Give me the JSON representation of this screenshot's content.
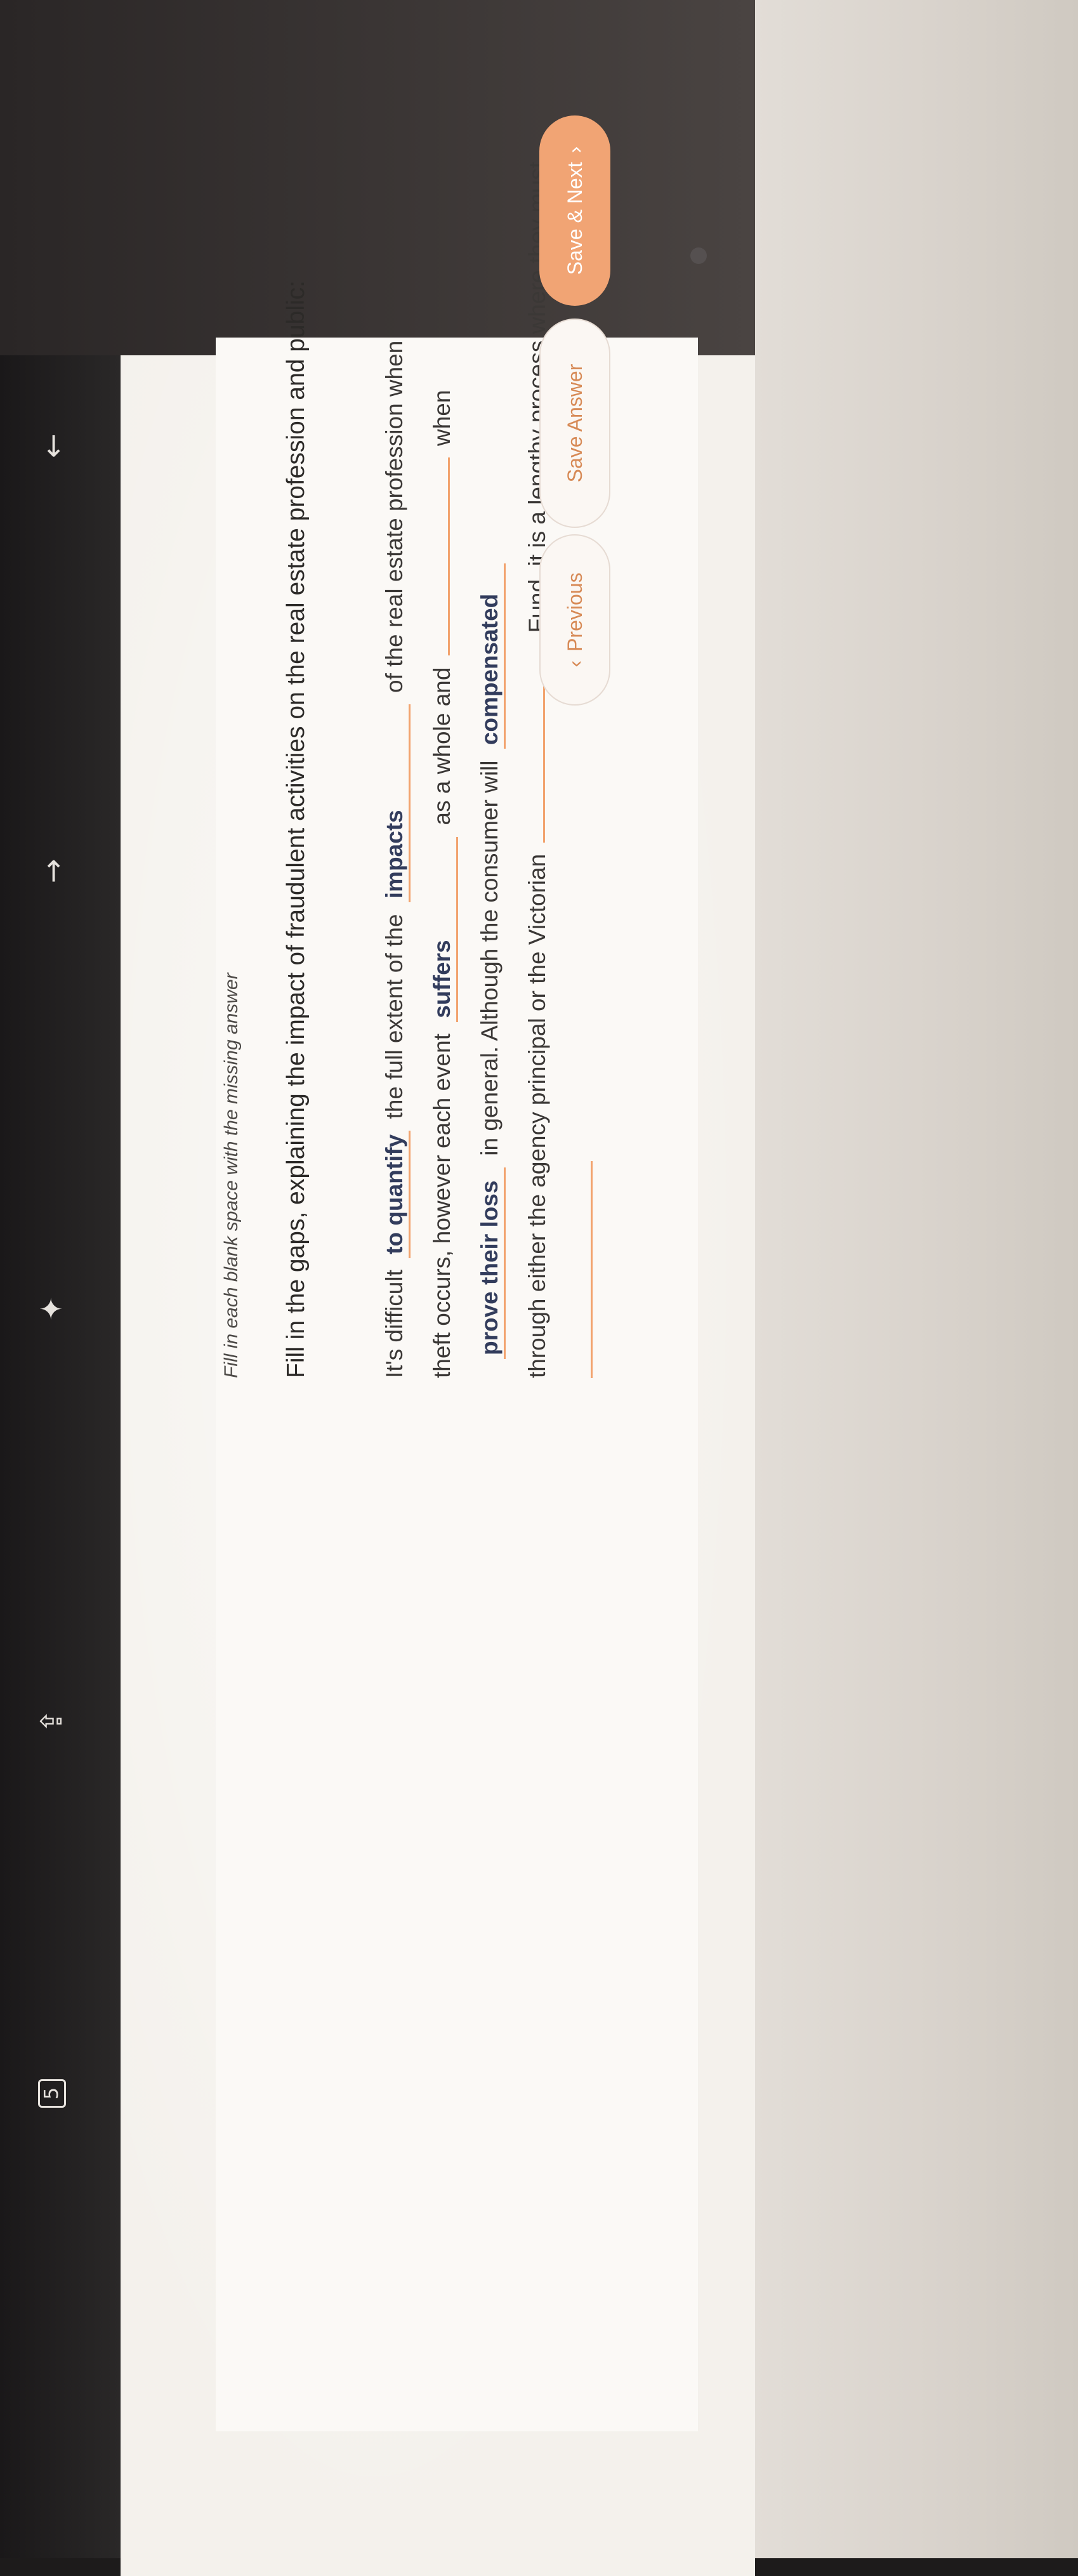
{
  "question": {
    "instruction": "Fill in each blank space with the missing answer",
    "prompt": "Fill in the gaps, explaining the impact of fraudulent activities on the real estate profession and public:",
    "lines": [
      {
        "parts": [
          {
            "text": "It's difficult "
          },
          {
            "blank": "to quantify"
          },
          {
            "text": " the full extent of the "
          },
          {
            "blank": "impacts"
          },
          {
            "text": " of the real estate profession when"
          }
        ]
      },
      {
        "parts": [
          {
            "text": "theft occurs, however each event "
          },
          {
            "blank": "suffers"
          },
          {
            "text": " as a whole and "
          },
          {
            "blank": ""
          },
          {
            "text": " when"
          }
        ]
      },
      {
        "parts": [
          {
            "blank": "prove their loss"
          },
          {
            "text": " in general. Although the consumer will "
          },
          {
            "blank": "compensated"
          }
        ]
      },
      {
        "parts": [
          {
            "text": "through either the agency principal or the Victorian "
          },
          {
            "blank": ""
          },
          {
            "text": " Fund, it is a lengthy process where they must"
          }
        ]
      },
      {
        "parts": [
          {
            "blank": ""
          }
        ]
      }
    ]
  },
  "buttons": {
    "previous": "Previous",
    "save": "Save Answer",
    "next": "Save & Next"
  },
  "icons": {
    "previous_chevron": "chevron-left-icon",
    "next_chevron": "chevron-right-icon",
    "back": "arrow-left-icon",
    "forward": "arrow-right-icon",
    "ai_assist": "ai-assist-icon",
    "share": "share-icon",
    "tabs": "tabs-icon"
  },
  "browser": {
    "tab_count": "5"
  },
  "colors": {
    "accent": "#f1a474",
    "accent_text": "#d78a56",
    "blank_underline": "#f2a36e",
    "answer_text": "#323c5c"
  }
}
